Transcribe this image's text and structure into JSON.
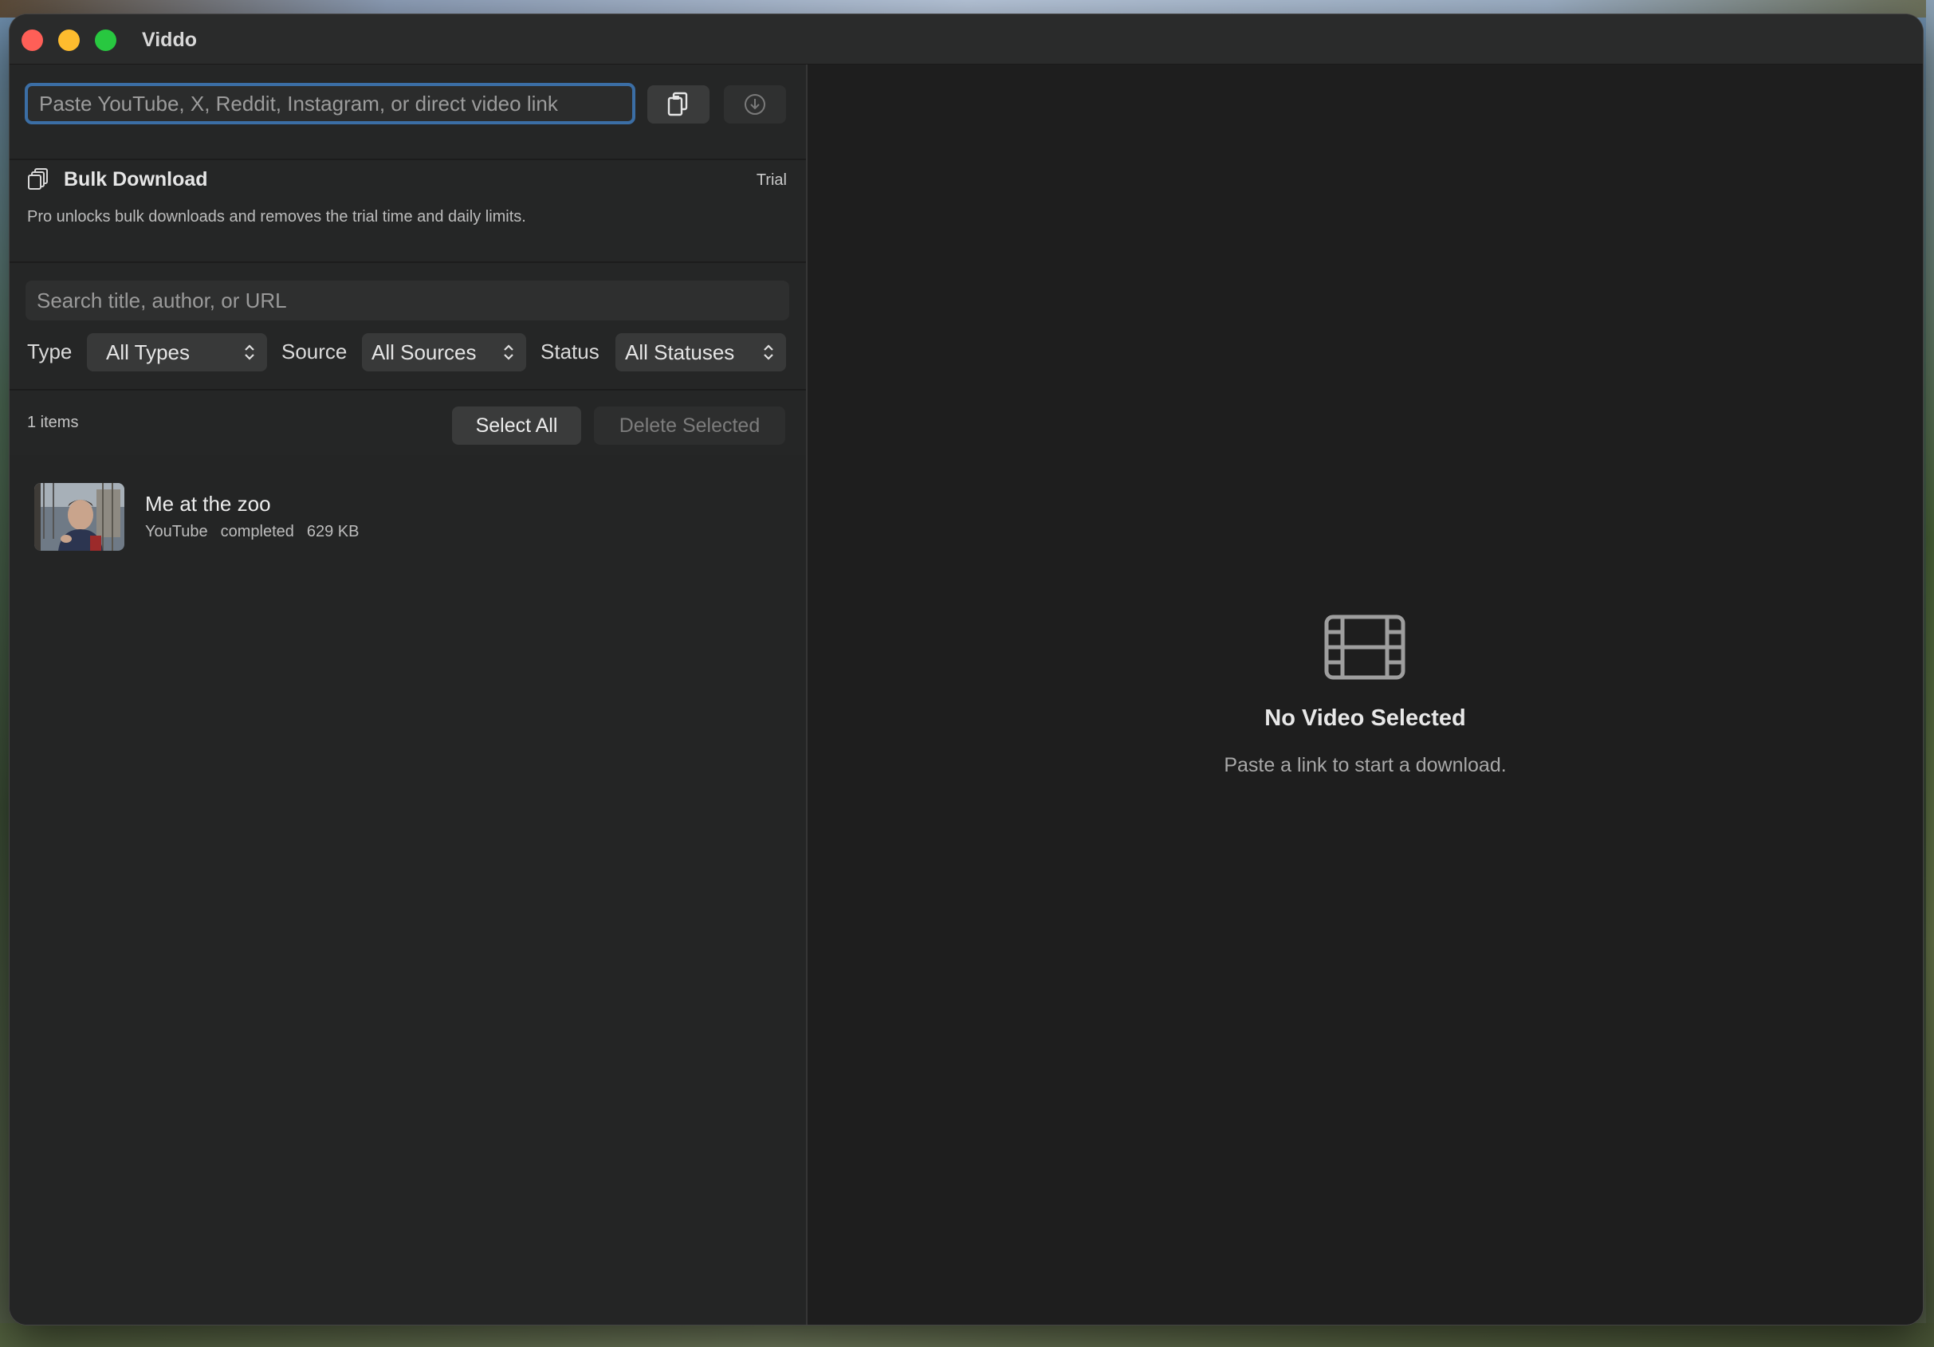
{
  "app": {
    "title": "Viddo"
  },
  "toolbar": {
    "url_placeholder": "Paste YouTube, X, Reddit, Instagram, or direct video link",
    "paste_icon": "clipboard-paste-icon",
    "download_icon": "download-circle-icon"
  },
  "bulk": {
    "title": "Bulk Download",
    "badge": "Trial",
    "description": "Pro unlocks bulk downloads and removes the trial time and daily limits."
  },
  "filters": {
    "search_placeholder": "Search title, author, or URL",
    "type_label": "Type",
    "type_value": "All Types",
    "source_label": "Source",
    "source_value": "All Sources",
    "status_label": "Status",
    "status_value": "All Statuses"
  },
  "list": {
    "count_text": "1 items",
    "select_all": "Select All",
    "delete_selected": "Delete Selected",
    "items": [
      {
        "title": "Me at the zoo",
        "source": "YouTube",
        "status": "completed",
        "size": "629 KB"
      }
    ]
  },
  "detail": {
    "empty_icon": "film-icon",
    "empty_title": "No Video Selected",
    "empty_subtitle": "Paste a link to start a download."
  },
  "colors": {
    "focus_ring": "#3b6ea5",
    "close": "#fe5f57",
    "minimize": "#febc2e",
    "zoom": "#28c840"
  }
}
